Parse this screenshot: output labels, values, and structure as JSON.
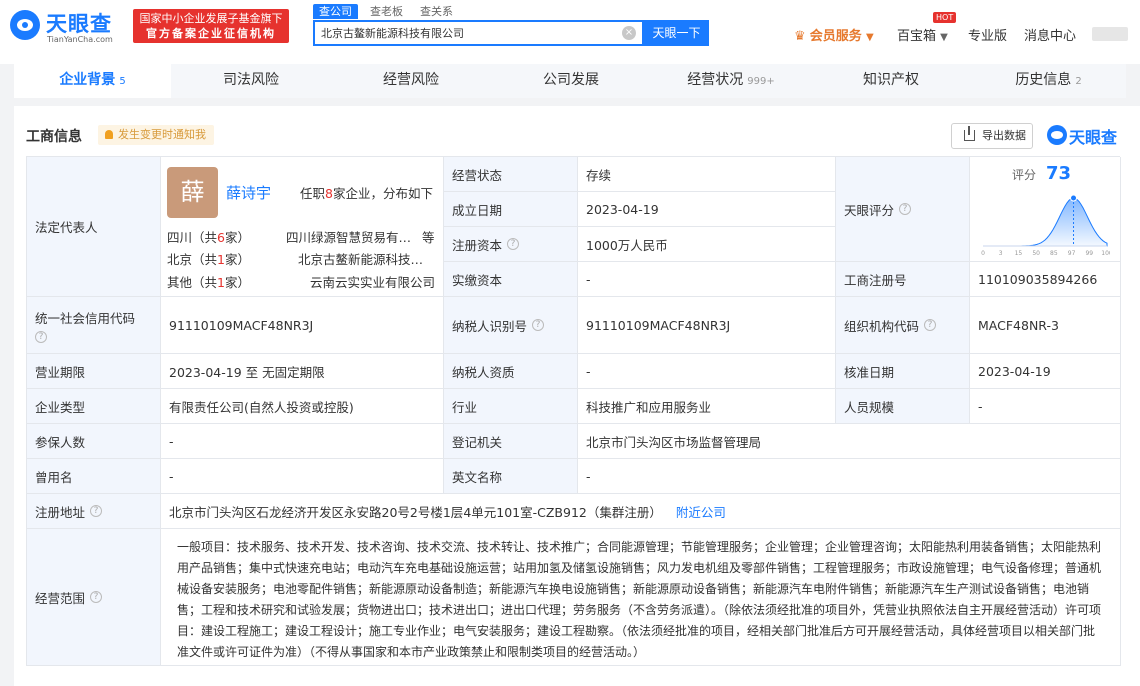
{
  "brand": {
    "name_cn": "天眼查",
    "name_en": "TianYanCha.com",
    "banner_line1": "国家中小企业发展子基金旗下",
    "banner_line2": "官方备案企业征信机构"
  },
  "search": {
    "tabs": [
      "查公司",
      "查老板",
      "查关系"
    ],
    "value": "北京古鳌新能源科技有限公司",
    "button": "天眼一下"
  },
  "nav": {
    "vip": "会员服务",
    "baoxiang": "百宝箱",
    "hot": "HOT",
    "pro": "专业版",
    "messages": "消息中心"
  },
  "tabs": [
    {
      "label": "企业背景",
      "count": "5"
    },
    {
      "label": "司法风险",
      "count": ""
    },
    {
      "label": "经营风险",
      "count": ""
    },
    {
      "label": "公司发展",
      "count": ""
    },
    {
      "label": "经营状况",
      "count": "999+"
    },
    {
      "label": "知识产权",
      "count": ""
    },
    {
      "label": "历史信息",
      "count": "2"
    }
  ],
  "section": {
    "title": "工商信息",
    "notice": "发生变更时通知我",
    "export": "导出数据",
    "brand": "天眼查"
  },
  "rep": {
    "label": "法定代表人",
    "avatar": "薛",
    "name": "薛诗宇",
    "desc_pre": "任职",
    "desc_num": "8",
    "desc_post": "家企业，分布如下",
    "rows": [
      {
        "region": "四川",
        "pre": "（共",
        "num": "6",
        "post": "家）",
        "company": "四川绿源智慧贸易有…",
        "suffix": "等"
      },
      {
        "region": "北京",
        "pre": "（共",
        "num": "1",
        "post": "家）",
        "company": "北京古鳌新能源科技…",
        "suffix": ""
      },
      {
        "region": "其他",
        "pre": "（共",
        "num": "1",
        "post": "家）",
        "company": "云南云实实业有限公司",
        "suffix": ""
      }
    ]
  },
  "fields": {
    "status_label": "经营状态",
    "status": "存续",
    "found_label": "成立日期",
    "found": "2023-04-19",
    "capital_label": "注册资本",
    "capital": "1000万人民币",
    "paid_label": "实缴资本",
    "paid": "-",
    "score_label": "天眼评分",
    "score_title": "评分",
    "score": "73",
    "regno_label": "工商注册号",
    "regno": "110109035894266",
    "credit_label": "统一社会信用代码",
    "credit": "91110109MACF48NR3J",
    "taxid_label": "纳税人识别号",
    "taxid": "91110109MACF48NR3J",
    "org_label": "组织机构代码",
    "org": "MACF48NR-3",
    "term_label": "营业期限",
    "term": "2023-04-19 至 无固定期限",
    "taxq_label": "纳税人资质",
    "taxq": "-",
    "approve_label": "核准日期",
    "approve": "2023-04-19",
    "type_label": "企业类型",
    "type": "有限责任公司(自然人投资或控股)",
    "industry_label": "行业",
    "industry": "科技推广和应用服务业",
    "staff_label": "人员规模",
    "staff": "-",
    "insured_label": "参保人数",
    "insured": "-",
    "authority_label": "登记机关",
    "authority": "北京市门头沟区市场监督管理局",
    "former_label": "曾用名",
    "former": "-",
    "en_label": "英文名称",
    "en": "-",
    "addr_label": "注册地址",
    "addr": "北京市门头沟区石龙经济开发区永安路20号2号楼1层4单元101室-CZB912（集群注册）",
    "addr_link": "附近公司",
    "scope_label": "经营范围",
    "scope": "一般项目：技术服务、技术开发、技术咨询、技术交流、技术转让、技术推广；合同能源管理；节能管理服务；企业管理；企业管理咨询；太阳能热利用装备销售；太阳能热利用产品销售；集中式快速充电站；电动汽车充电基础设施运营；站用加氢及储氢设施销售；风力发电机组及零部件销售；工程管理服务；市政设施管理；电气设备修理；普通机械设备安装服务；电池零配件销售；新能源原动设备制造；新能源汽车换电设施销售；新能源原动设备销售；新能源汽车电附件销售；新能源汽车生产测试设备销售；电池销售；工程和技术研究和试验发展；货物进出口；技术进出口；进出口代理；劳务服务（不含劳务派遣）。（除依法须经批准的项目外，凭营业执照依法自主开展经营活动）许可项目：建设工程施工；建设工程设计；施工专业作业；电气安装服务；建设工程勘察。（依法须经批准的项目，经相关部门批准后方可开展经营活动，具体经营项目以相关部门批准文件或许可证件为准）（不得从事国家和本市产业政策禁止和限制类项目的经营活动。）"
  },
  "chart_data": {
    "type": "area",
    "title": "评分",
    "x": [
      0,
      3,
      15,
      50,
      85,
      97,
      99,
      100
    ],
    "ylim": [
      0,
      1
    ],
    "highlight": 73
  }
}
